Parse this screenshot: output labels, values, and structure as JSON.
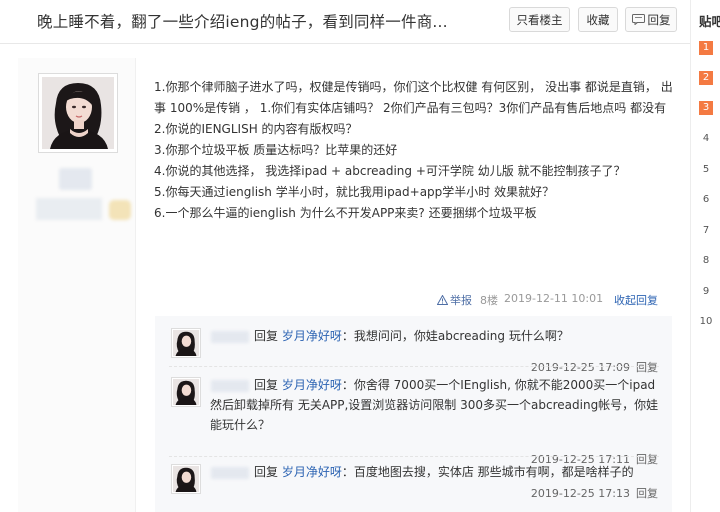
{
  "thread": {
    "title": "晚上睡不着，翻了一些介绍ieng的帖子，看到同样一件商...",
    "only_owner": "只看楼主",
    "favorite": "收藏",
    "reply": "回复"
  },
  "sidebar": {
    "title": "贴吧",
    "ranks": [
      "1",
      "2",
      "3",
      "4",
      "5",
      "6",
      "7",
      "8",
      "9",
      "10"
    ]
  },
  "post": {
    "lines": [
      "1.你那个律师脑子进水了吗，权健是传销吗，你们这个比权健 有何区别， 没出事 都说是直销， 出事 100%是传销 ， 1.你们有实体店铺吗？ 2你们产品有三包吗？3你们产品有售后地点吗 都没有",
      "2.你说的IENGLISH 的内容有版权吗？",
      "3.你那个垃圾平板 质量达标吗？比苹果的还好",
      "4.你说的其他选择， 我选择ipad + abcreading +可汗学院 幼儿版 就不能控制孩子了？",
      "5.你每天通过ienglish 学半小时，就比我用ipad+app学半小时 效果就好？",
      "6.一个那么牛逼的ienglish 为什么不开发APP来卖? 还要捆绑个垃圾平板"
    ],
    "report": "举报",
    "floor": "8楼",
    "time": "2019-12-11 10:01",
    "collapse": "收起回复"
  },
  "replies": [
    {
      "reply_word": "回复",
      "target": "岁月净好呀",
      "text": "：我想问问，你娃abcreading 玩什么啊？",
      "time": "2019-12-25 17:09",
      "reply_link": "回复"
    },
    {
      "reply_word": "回复",
      "target": "岁月净好呀",
      "text": "：你舍得 7000买一个IEnglish, 你就不能2000买一个ipad 然后卸载掉所有 无关APP,设置浏览器访问限制 300多买一个abcreading帐号，你娃能玩什么？",
      "time": "2019-12-25 17:11",
      "reply_link": "回复"
    },
    {
      "reply_word": "回复",
      "target": "岁月净好呀",
      "text": "：百度地图去搜，实体店 那些城市有啊，都是啥样子的",
      "time": "2019-12-25 17:13",
      "reply_link": "回复"
    }
  ],
  "colors": {
    "link_blue": "#2d64b3",
    "rank_orange": "#f47a42",
    "reply_bg": "#f7f8fa"
  }
}
